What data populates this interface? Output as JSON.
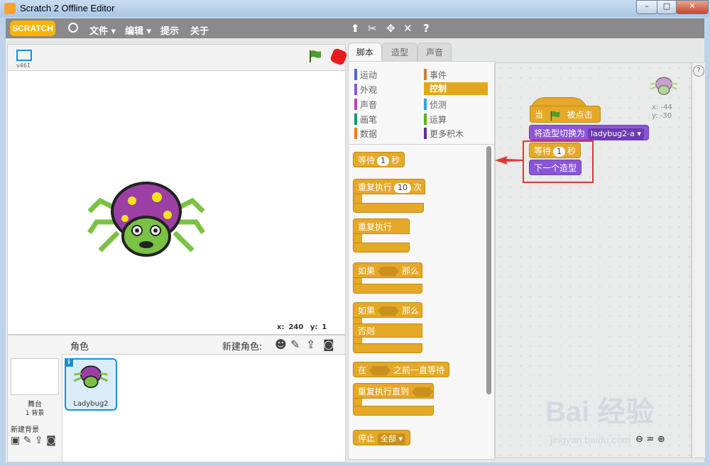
{
  "window": {
    "title": "Scratch 2 Offline Editor"
  },
  "menubar": {
    "logo": "SCRATCH",
    "items": [
      "文件 ▾",
      "编辑 ▾",
      "提示",
      "关于"
    ]
  },
  "stage": {
    "version": "v461",
    "x_label": "x:",
    "x_value": "240",
    "y_label": "y:",
    "y_value": "1"
  },
  "sprites": {
    "title": "角色",
    "new_sprite": "新建角色:",
    "stage_name": "舞台",
    "stage_backdrops": "1 背景",
    "new_backdrop": "新建背景",
    "sprite_name": "Ladybug2",
    "info": "i"
  },
  "tabs": [
    "脚本",
    "造型",
    "声音"
  ],
  "categories": {
    "left": [
      "运动",
      "外观",
      "声音",
      "画笔",
      "数据"
    ],
    "right": [
      "事件",
      "控制",
      "侦测",
      "运算",
      "更多积木"
    ],
    "colors_left": [
      "#4a6cd4",
      "#8a55d7",
      "#bb42c3",
      "#0e9a6c",
      "#ee7d16"
    ],
    "colors_right": [
      "#c88330",
      "#e1a91a",
      "#2ca5e2",
      "#5cb712",
      "#632d99"
    ]
  },
  "palette_blocks": {
    "wait": "等待",
    "wait_num": "1",
    "wait_unit": "秒",
    "repeat": "重复执行",
    "repeat_num": "10",
    "repeat_unit": "次",
    "forever": "重复执行",
    "if": "如果",
    "then": "那么",
    "if2": "如果",
    "then2": "那么",
    "else": "否则",
    "wait_until_a": "在",
    "wait_until_b": "之前一直等待",
    "repeat_until": "重复执行直到",
    "stop": "停止",
    "stop_opt": "全部 ▾"
  },
  "script": {
    "hat_a": "当",
    "hat_b": "被点击",
    "switch_costume": "将造型切换为",
    "costume_name": "ladybug2-a ▾",
    "wait": "等待",
    "wait_num": "1",
    "wait_unit": "秒",
    "next_costume": "下一个造型",
    "sprite_x": "x: -44",
    "sprite_y": "y: -30"
  },
  "watermark": {
    "text": "Bai 经验",
    "url": "jingyan.baidu.com"
  }
}
